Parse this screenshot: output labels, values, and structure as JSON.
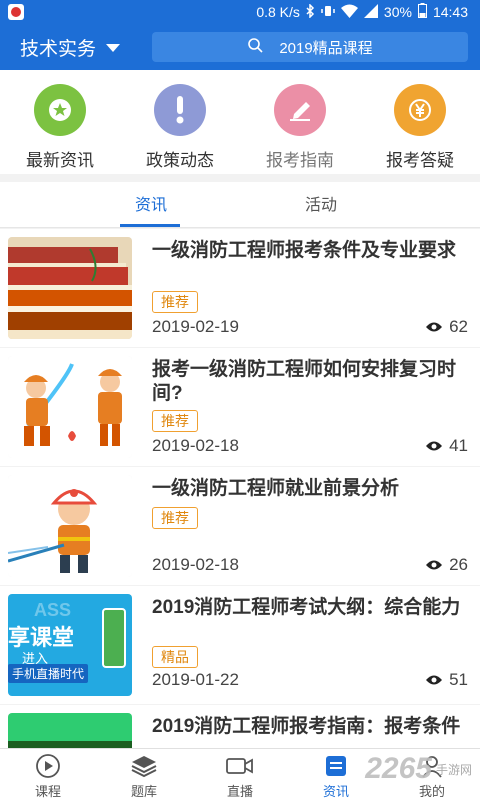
{
  "status_bar": {
    "speed": "0.8 K/s",
    "battery": "30%",
    "time": "14:43"
  },
  "header": {
    "category": "技术实务",
    "search_text": "2019精品课程"
  },
  "quick_nav": [
    {
      "label": "最新资讯",
      "icon": "star-icon",
      "color": "#7cc241"
    },
    {
      "label": "政策动态",
      "icon": "exclamation-icon",
      "color": "#8e9ad6"
    },
    {
      "label": "报考指南",
      "icon": "pencil-icon",
      "color": "#eb8fa6"
    },
    {
      "label": "报考答疑",
      "icon": "yen-icon",
      "color": "#f0a431"
    }
  ],
  "tabs": [
    {
      "label": "资讯",
      "active": true
    },
    {
      "label": "活动",
      "active": false
    }
  ],
  "articles": [
    {
      "title": "一级消防工程师报考条件及专业要求",
      "badge": "推荐",
      "date": "2019-02-19",
      "views": "62",
      "thumb": "books-image"
    },
    {
      "title": "报考一级消防工程师如何安排复习时间?",
      "badge": "推荐",
      "date": "2019-02-18",
      "views": "41",
      "thumb": "firefighters-cartoon-image"
    },
    {
      "title": "一级消防工程师就业前景分析",
      "badge": "推荐",
      "date": "2019-02-18",
      "views": "26",
      "thumb": "firefighter-hose-cartoon-image"
    },
    {
      "title": "2019消防工程师考试大纲：综合能力",
      "badge": "精品",
      "date": "2019-01-22",
      "views": "51",
      "thumb": "classroom-banner-image"
    },
    {
      "title": "2019消防工程师报考指南：报考条件",
      "badge": "",
      "date": "",
      "views": "",
      "thumb": "green-banner-image"
    }
  ],
  "thumb_text": {
    "ass": "ASS",
    "classroom": "享课堂",
    "enter": "进入",
    "live": "手机直播时代"
  },
  "bottom_nav": [
    {
      "label": "课程",
      "icon": "play-circle-icon",
      "active": false
    },
    {
      "label": "题库",
      "icon": "layers-icon",
      "active": false
    },
    {
      "label": "直播",
      "icon": "video-camera-icon",
      "active": false
    },
    {
      "label": "资讯",
      "icon": "news-icon",
      "active": true
    },
    {
      "label": "我的",
      "icon": "user-icon",
      "active": false
    }
  ],
  "watermark": {
    "brand": "2265",
    "sub": "手游网"
  },
  "colors": {
    "primary": "#1d6ed6",
    "badge": "#e08810"
  }
}
